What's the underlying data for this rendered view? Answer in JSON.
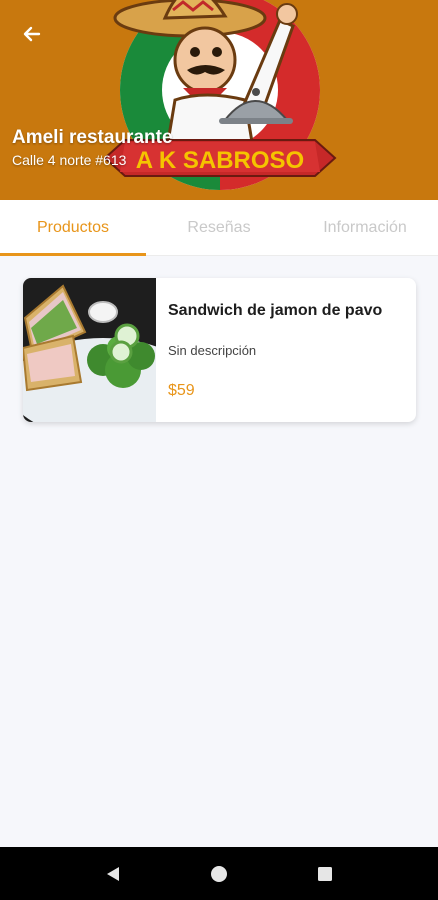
{
  "header": {
    "restaurant_name": "Ameli restaurante",
    "address": "Calle 4 norte #613",
    "logo_text": "A K SABROSO",
    "background_color": "#c8780e"
  },
  "tabs": [
    {
      "label": "Productos",
      "active": true
    },
    {
      "label": "Reseñas",
      "active": false
    },
    {
      "label": "Información",
      "active": false
    }
  ],
  "products": [
    {
      "name": "Sandwich de jamon de pavo",
      "description": "Sin descripción",
      "price": "$59",
      "image": "sandwich-photo"
    }
  ],
  "icons": {
    "back": "arrow-left-icon",
    "nav_back": "triangle-back-icon",
    "nav_home": "circle-home-icon",
    "nav_recents": "square-recents-icon"
  },
  "colors": {
    "accent": "#e8951a",
    "inactive_tab": "#c9c9c9"
  }
}
